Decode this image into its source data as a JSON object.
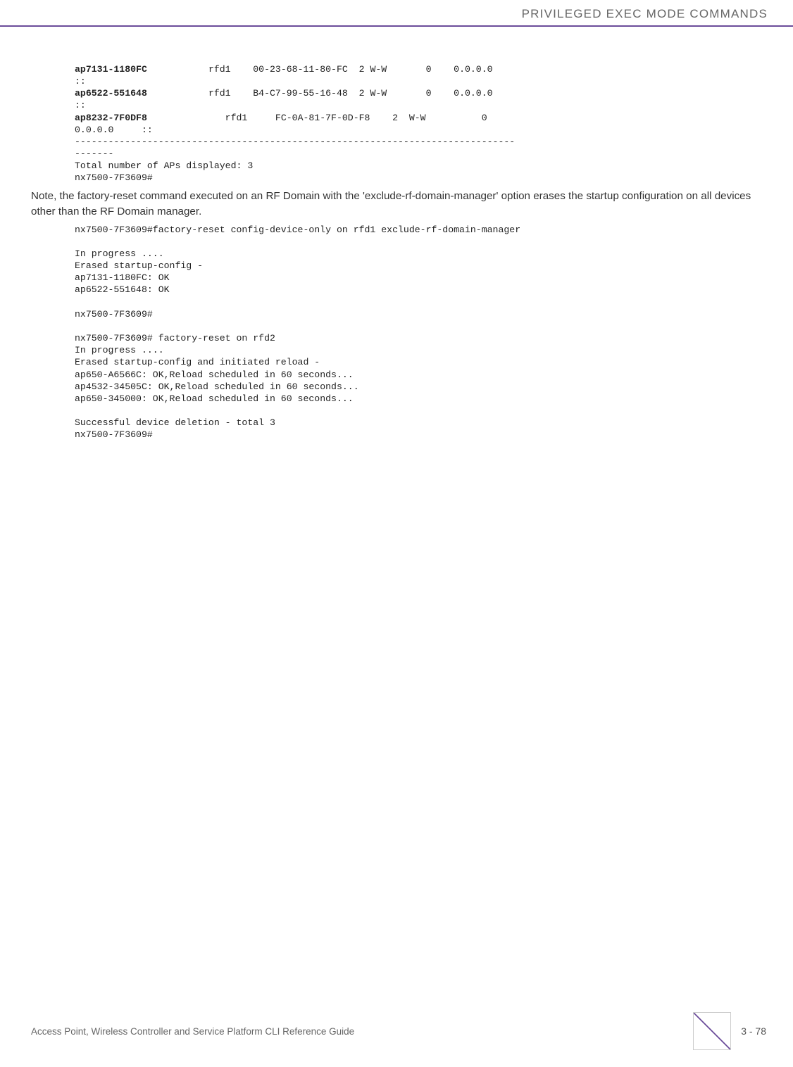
{
  "header": {
    "title": "PRIVILEGED EXEC MODE COMMANDS"
  },
  "block1": {
    "l1a": "ap7131-1180FC",
    "l1b": "           rfd1    00-23-68-11-80-FC  2 W-W       0    0.0.0.0",
    "l2": "::",
    "l3a": "ap6522-551648",
    "l3b": "           rfd1    B4-C7-99-55-16-48  2 W-W       0    0.0.0.0",
    "l4": "::",
    "l5a": "ap8232-7F0DF8",
    "l5b": "              rfd1     FC-0A-81-7F-0D-F8    2  W-W          0",
    "l6": "0.0.0.0     ::",
    "l7": "-------------------------------------------------------------------------------",
    "l8": "-------",
    "l9": "Total number of APs displayed: 3",
    "l10": "nx7500-7F3609#"
  },
  "para": {
    "p1": "Note, the factory-reset command executed on an RF Domain with the 'exclude-rf-domain-manager' option erases the startup configuration on all devices other than the RF Domain manager."
  },
  "block2": {
    "l1": "nx7500-7F3609#factory-reset config-device-only on rfd1 exclude-rf-domain-manager",
    "l2": "",
    "l3": "In progress ....",
    "l4": "Erased startup-config -",
    "l5": "ap7131-1180FC: OK",
    "l6": "ap6522-551648: OK",
    "l7": "",
    "l8": "nx7500-7F3609#",
    "l9": "",
    "l10": "nx7500-7F3609# factory-reset on rfd2",
    "l11": "In progress ....",
    "l12": "Erased startup-config and initiated reload -",
    "l13": "ap650-A6566C: OK,Reload scheduled in 60 seconds...",
    "l14": "ap4532-34505C: OK,Reload scheduled in 60 seconds...",
    "l15": "ap650-345000: OK,Reload scheduled in 60 seconds...",
    "l16": "",
    "l17": "Successful device deletion - total 3",
    "l18": "nx7500-7F3609#"
  },
  "footer": {
    "left": "Access Point, Wireless Controller and Service Platform CLI Reference Guide",
    "page": "3 - 78"
  }
}
